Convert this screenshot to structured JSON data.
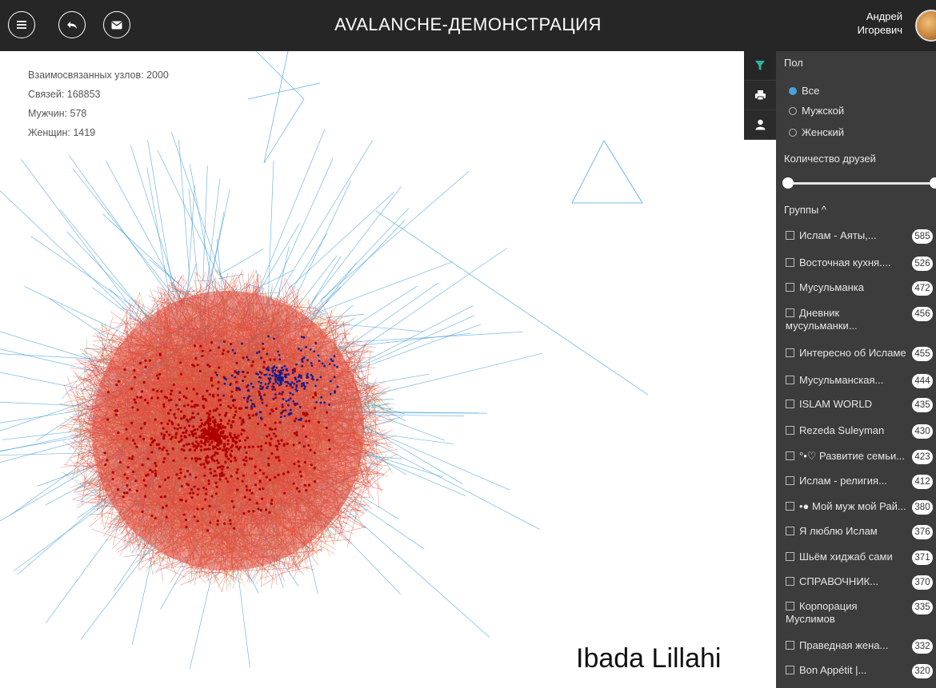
{
  "header": {
    "title": "AVALANCHE-ДЕМОНСТРАЦИЯ",
    "user_first": "Андрей",
    "user_last": "Игоревич",
    "buttons": [
      "menu-icon",
      "back-icon",
      "mail-icon"
    ]
  },
  "stats": {
    "nodes": "Взаимосвязанных узлов: 2000",
    "links": "Связей: 168853",
    "men": "Мужчин: 578",
    "women": "Женщин: 1419"
  },
  "sidetabs": [
    "filter-icon",
    "print-icon",
    "user-icon"
  ],
  "filters": {
    "gender_title": "Пол",
    "gender_options": [
      {
        "label": "Все",
        "selected": true
      },
      {
        "label": "Мужской",
        "selected": false
      },
      {
        "label": "Женский",
        "selected": false
      }
    ],
    "friends_title": "Количество друзей",
    "friends_range": [
      0,
      1
    ],
    "groups_title": "Группы ^",
    "groups": [
      {
        "lines": [
          "Ислам - Аяты,..."
        ],
        "count": "585"
      },
      {
        "lines": [
          "Восточная кухня...."
        ],
        "count": "526"
      },
      {
        "lines": [
          "Мусульманка"
        ],
        "count": "472"
      },
      {
        "lines": [
          "Дневник",
          "мусульманки..."
        ],
        "count": "456"
      },
      {
        "lines": [
          "Интересно об Исламе"
        ],
        "count": "455"
      },
      {
        "lines": [
          "Мусульманская..."
        ],
        "count": "444"
      },
      {
        "lines": [
          "ISLAM WORLD"
        ],
        "count": "435"
      },
      {
        "lines": [
          "Rezeda Suleyman"
        ],
        "count": "430"
      },
      {
        "lines": [
          "°•♡ Развитие семьи..."
        ],
        "count": "423"
      },
      {
        "lines": [
          "Ислам - религия..."
        ],
        "count": "412"
      },
      {
        "lines": [
          "•● Мой муж мой Рай..."
        ],
        "count": "380"
      },
      {
        "lines": [
          "Я люблю Ислам"
        ],
        "count": "376"
      },
      {
        "lines": [
          "Шьём хиджаб сами"
        ],
        "count": "371"
      },
      {
        "lines": [
          "СПРАВОЧНИК..."
        ],
        "count": "370"
      },
      {
        "lines": [
          "Корпорация",
          "Муслимов"
        ],
        "count": "335"
      },
      {
        "lines": [
          "Праведная жена..."
        ],
        "count": "332"
      },
      {
        "lines": [
          "Bon Appétit |..."
        ],
        "count": "320"
      }
    ]
  },
  "watermark": "Ibada Lillahi",
  "colors": {
    "header_bg": "#262626",
    "panel_bg": "#3c3c3c",
    "accent": "#2ab3a6",
    "edge_primary": "#e04a3a",
    "edge_secondary": "#3a9ad9",
    "node_female": "#b00000",
    "node_male": "#1a1a8a"
  }
}
